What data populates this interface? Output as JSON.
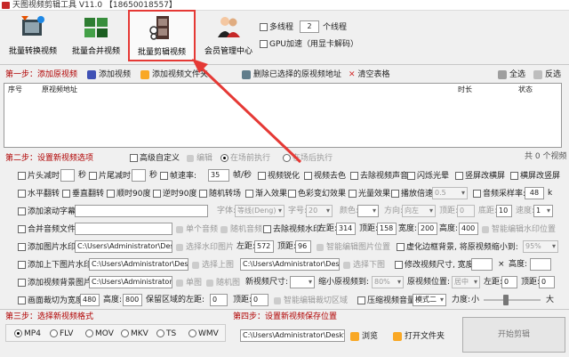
{
  "window": {
    "title": "天图视频剪辑工具 V11.0 【18650018557】"
  },
  "toolbar": {
    "batch_convert": "批量转换视频",
    "batch_merge": "批量合并视频",
    "batch_cut": "批量剪辑视频",
    "member": "会员管理中心",
    "multithread": "多线程",
    "thread_count": "2",
    "thread_unit": "个线程",
    "gpu": "GPU加速（用显卡解码）"
  },
  "step1": {
    "label": "第一步：添加原视频",
    "add_video": "添加视频",
    "add_folder": "添加视频文件夹",
    "delete_selected": "删除已选择的原视频地址",
    "clear_table": "清空表格",
    "select_all": "全选",
    "invert": "反选",
    "columns": [
      "序号",
      "原视频地址",
      "时长",
      "状态"
    ]
  },
  "step2": {
    "label": "第二步：设置新视频选项",
    "advanced": "高级自定义",
    "edit": "编辑",
    "before_cut": "在场前执行",
    "after_cut": "在场后执行",
    "total": "共 0 个视频",
    "row1": {
      "head_cut": "片头减时:",
      "head_val": "",
      "sec": "秒",
      "tail_cut": "片尾减时:",
      "tail_val": "",
      "sec2": "秒",
      "fps": "帧速率:",
      "fps_val": "35",
      "fps_unit": "帧/秒",
      "sharpen": "视频锐化",
      "decolor": "视频去色",
      "mute": "去除视频声音",
      "blink": "闪烁光晕",
      "vertical": "竖屏改横屏",
      "horizontal": "横屏改竖屏"
    },
    "row2": {
      "hflip": "水平翻转",
      "vflip": "垂直翻转",
      "rot90": "顺时90度",
      "rot_ccw": "逆时90度",
      "random_trans": "随机转场",
      "fade_in": "渐入效果",
      "color_shift": "色彩变幻效果",
      "light": "光量效果",
      "speed": "播放倍速:",
      "speed_val": "0.5",
      "sample": "音频采样率:",
      "sample_val": "48",
      "sample_unit": "k"
    },
    "row3": {
      "scroll_text": "添加滚动字幕:",
      "font": "字体:",
      "font_val": "等线(Deng)",
      "size": "字号:",
      "size_val": "20",
      "color": "颜色:",
      "direction": "方向:",
      "dir_val": "向左",
      "top": "顶距:",
      "top_val": "0",
      "bottom": "底距:",
      "bottom_val": "10",
      "speed": "速度:",
      "speed_val": "1"
    },
    "row4": {
      "merge_audio": "合并音频文件:",
      "single_audio": "单个音频",
      "random_audio": "随机音频",
      "watermark": "去除视频水印",
      "left": "左距:",
      "left_val": "314",
      "top": "顶距:",
      "top_val": "158",
      "width": "宽度:",
      "width_val": "200",
      "height": "高度:",
      "height_val": "400",
      "smart": "智能编辑水印位置"
    },
    "row5": {
      "image_wm": "添加图片水印:",
      "path": "C:\\Users\\Administrator\\Desktop\\BBD\\g",
      "choose": "选择水印图片",
      "left": "左距:",
      "left_val": "572",
      "top": "顶距:",
      "top_val": "96",
      "smart": "智能编辑图片位置",
      "blur_bg": "虚化边框背景, 将原视频缩小到:",
      "blur_val": "95%"
    },
    "row6": {
      "top_bottom": "添加上下图片水印:",
      "path": "C:\\Users\\Administrator\\Desktop\\",
      "choose_top": "选择上图",
      "path2": "C:\\Users\\Administrator\\Desktop\\",
      "choose_bottom": "选择下图",
      "resize": "修改视频尺寸, 宽度:",
      "x": "×",
      "height": "高度:"
    },
    "row7": {
      "bg_image": "添加视频背景图片:",
      "path": "C:\\Users\\Administrator\\Desktop\\",
      "single": "单图",
      "random": "随机图",
      "new_size": "新视频尺寸:",
      "shrink": "缩小原视频到:",
      "shrink_val": "80%",
      "position": "原视频位置:",
      "pos_val": "居中",
      "left": "左距:",
      "left_val": "0",
      "top": "顶距:",
      "top_val": "0"
    },
    "row8": {
      "crop": "画面裁切为宽度:",
      "crop_w": "480",
      "height": "高度:",
      "crop_h": "800",
      "keep_left": "保留区域的左距:",
      "keep_left_val": "0",
      "top": "顶距:",
      "top_val": "0",
      "smart": "智能编辑裁切区域",
      "compress": "压缩视频音量",
      "mode": "模式二",
      "volume": "力度:",
      "small": "小",
      "big": "大"
    }
  },
  "step3": {
    "label": "第三步：选择新视频格式",
    "formats": [
      "MP4",
      "FLV",
      "MOV",
      "MKV",
      "TS",
      "WMV"
    ],
    "selected": "MP4"
  },
  "step4": {
    "label": "第四步：设置新视频保存位置",
    "path": "C:\\Users\\Administrator\\Desktop",
    "browse": "浏览",
    "open": "打开文件夹",
    "start": "开始剪辑"
  },
  "colors": {
    "accent_red": "#e53935",
    "step_red": "#b00000"
  }
}
